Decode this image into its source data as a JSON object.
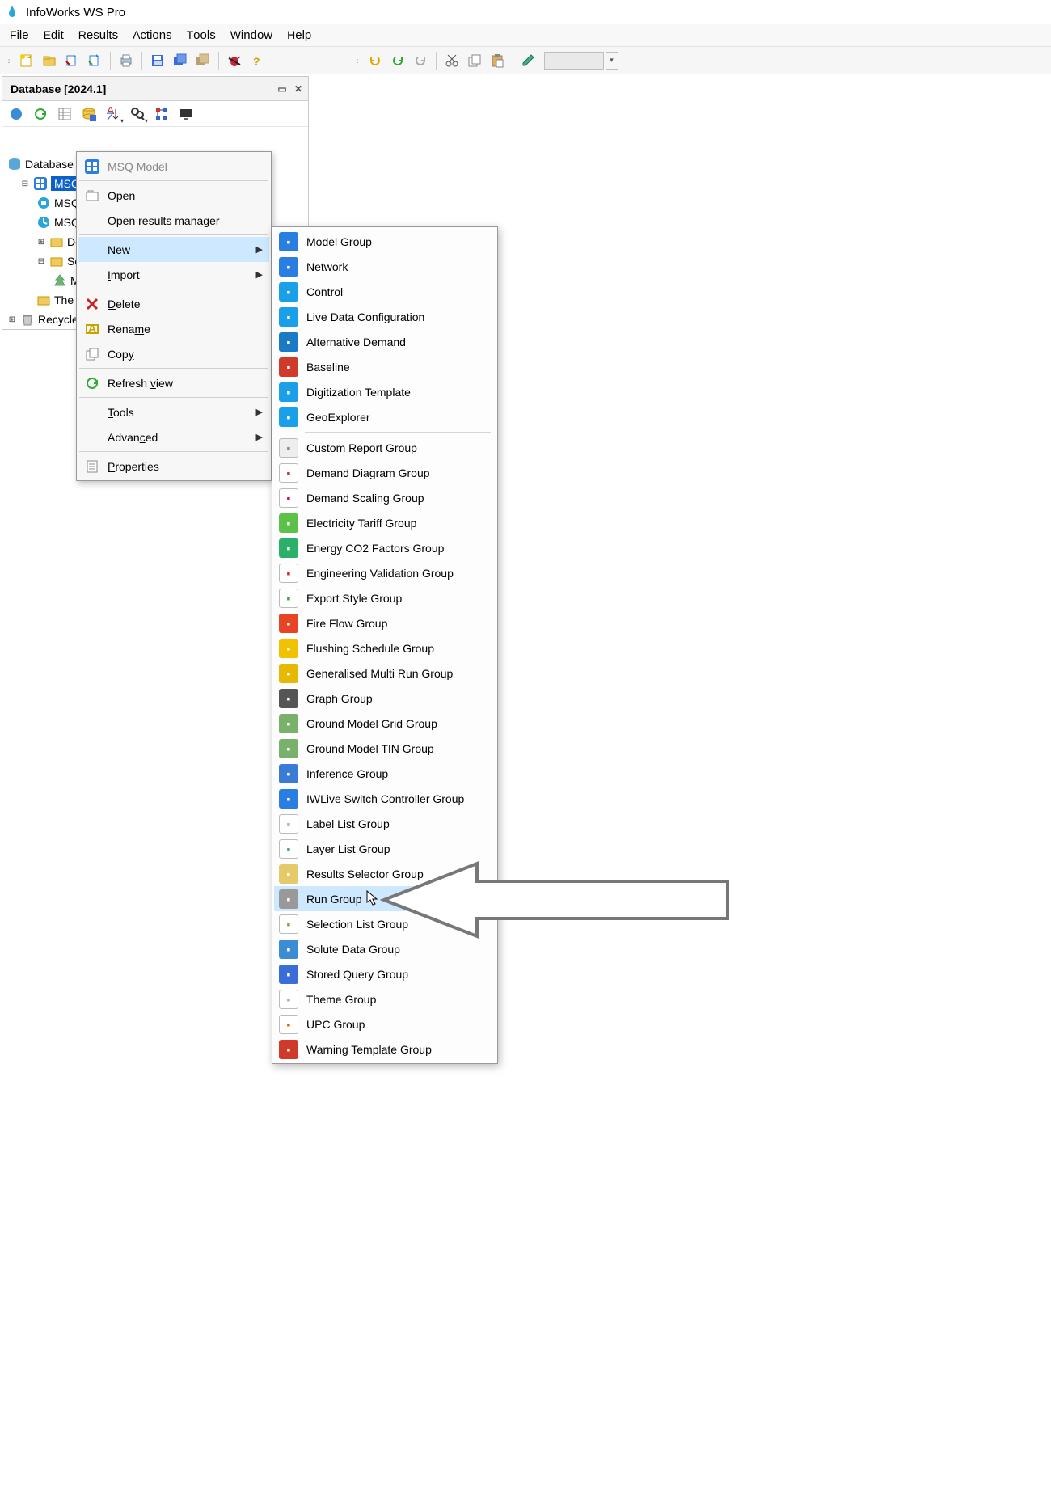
{
  "app_title": "InfoWorks WS Pro",
  "menubar": [
    "File",
    "Edit",
    "Results",
    "Actions",
    "Tools",
    "Window",
    "Help"
  ],
  "panel_title": "Database [2024.1]",
  "tree": {
    "root": "Database [",
    "selected": "MSQ M",
    "items": [
      "MSQ",
      "MSQ",
      "Dem",
      "Solu",
      "M",
      "The",
      "Recycle Bi"
    ]
  },
  "context_menu": {
    "title": "MSQ Model",
    "items": [
      {
        "label": "Open",
        "icon": "open"
      },
      {
        "label": "Open results manager"
      },
      {
        "label": "New",
        "icon": "",
        "sub": true,
        "highlight": true
      },
      {
        "label": "Import",
        "sub": true
      },
      {
        "label": "Delete",
        "icon": "delete"
      },
      {
        "label": "Rename",
        "icon": "rename"
      },
      {
        "label": "Copy",
        "icon": "copy"
      },
      {
        "label": "Refresh view",
        "icon": "refresh"
      },
      {
        "label": "Tools",
        "sub": true
      },
      {
        "label": "Advanced",
        "sub": true
      },
      {
        "label": "Properties",
        "icon": "props"
      }
    ]
  },
  "sub_menu": [
    {
      "label": "Model Group",
      "color": "#2a7de1"
    },
    {
      "label": "Network",
      "color": "#2a7de1"
    },
    {
      "label": "Control",
      "color": "#1aa0e8"
    },
    {
      "label": "Live Data Configuration",
      "color": "#1aa0e8"
    },
    {
      "label": "Alternative Demand",
      "color": "#1a7ac5"
    },
    {
      "label": "Baseline",
      "color": "#d03a2a"
    },
    {
      "label": "Digitization Template",
      "color": "#1aa0e8"
    },
    {
      "label": "GeoExplorer",
      "color": "#1aa0e8",
      "sep_after": true
    },
    {
      "label": "Custom Report Group",
      "color": "#eee",
      "fg": "#888"
    },
    {
      "label": "Demand Diagram Group",
      "color": "#fff",
      "fg": "#c33"
    },
    {
      "label": "Demand Scaling Group",
      "color": "#fff",
      "fg": "#d06"
    },
    {
      "label": "Electricity Tariff Group",
      "color": "#5cc247"
    },
    {
      "label": "Energy CO2 Factors Group",
      "color": "#2bb06a"
    },
    {
      "label": "Engineering Validation Group",
      "color": "#fff",
      "fg": "#d22"
    },
    {
      "label": "Export Style Group",
      "color": "#fff",
      "fg": "#3a3"
    },
    {
      "label": "Fire Flow Group",
      "color": "#e64425"
    },
    {
      "label": "Flushing Schedule Group",
      "color": "#f2c200"
    },
    {
      "label": "Generalised Multi Run Group",
      "color": "#e6b800"
    },
    {
      "label": "Graph Group",
      "color": "#555"
    },
    {
      "label": "Ground Model Grid Group",
      "color": "#79b06a"
    },
    {
      "label": "Ground Model TIN Group",
      "color": "#79b06a"
    },
    {
      "label": "Inference Group",
      "color": "#3a7bd5"
    },
    {
      "label": "IWLive Switch Controller Group",
      "color": "#2a7de1"
    },
    {
      "label": "Label List Group",
      "color": "#fff",
      "fg": "#caa"
    },
    {
      "label": "Layer List Group",
      "color": "#fff",
      "fg": "#4a8"
    },
    {
      "label": "Results Selector Group",
      "color": "#e6c968"
    },
    {
      "label": "Run Group",
      "color": "#999",
      "highlight": true
    },
    {
      "label": "Selection List Group",
      "color": "#fff",
      "fg": "#7a4"
    },
    {
      "label": "Solute Data Group",
      "color": "#3a8dd5"
    },
    {
      "label": "Stored Query Group",
      "color": "#3a6dd5"
    },
    {
      "label": "Theme Group",
      "color": "#fff",
      "fg": "#aaa"
    },
    {
      "label": "UPC Group",
      "color": "#fff",
      "fg": "#c60"
    },
    {
      "label": "Warning Template Group",
      "color": "#d03a2a"
    }
  ]
}
